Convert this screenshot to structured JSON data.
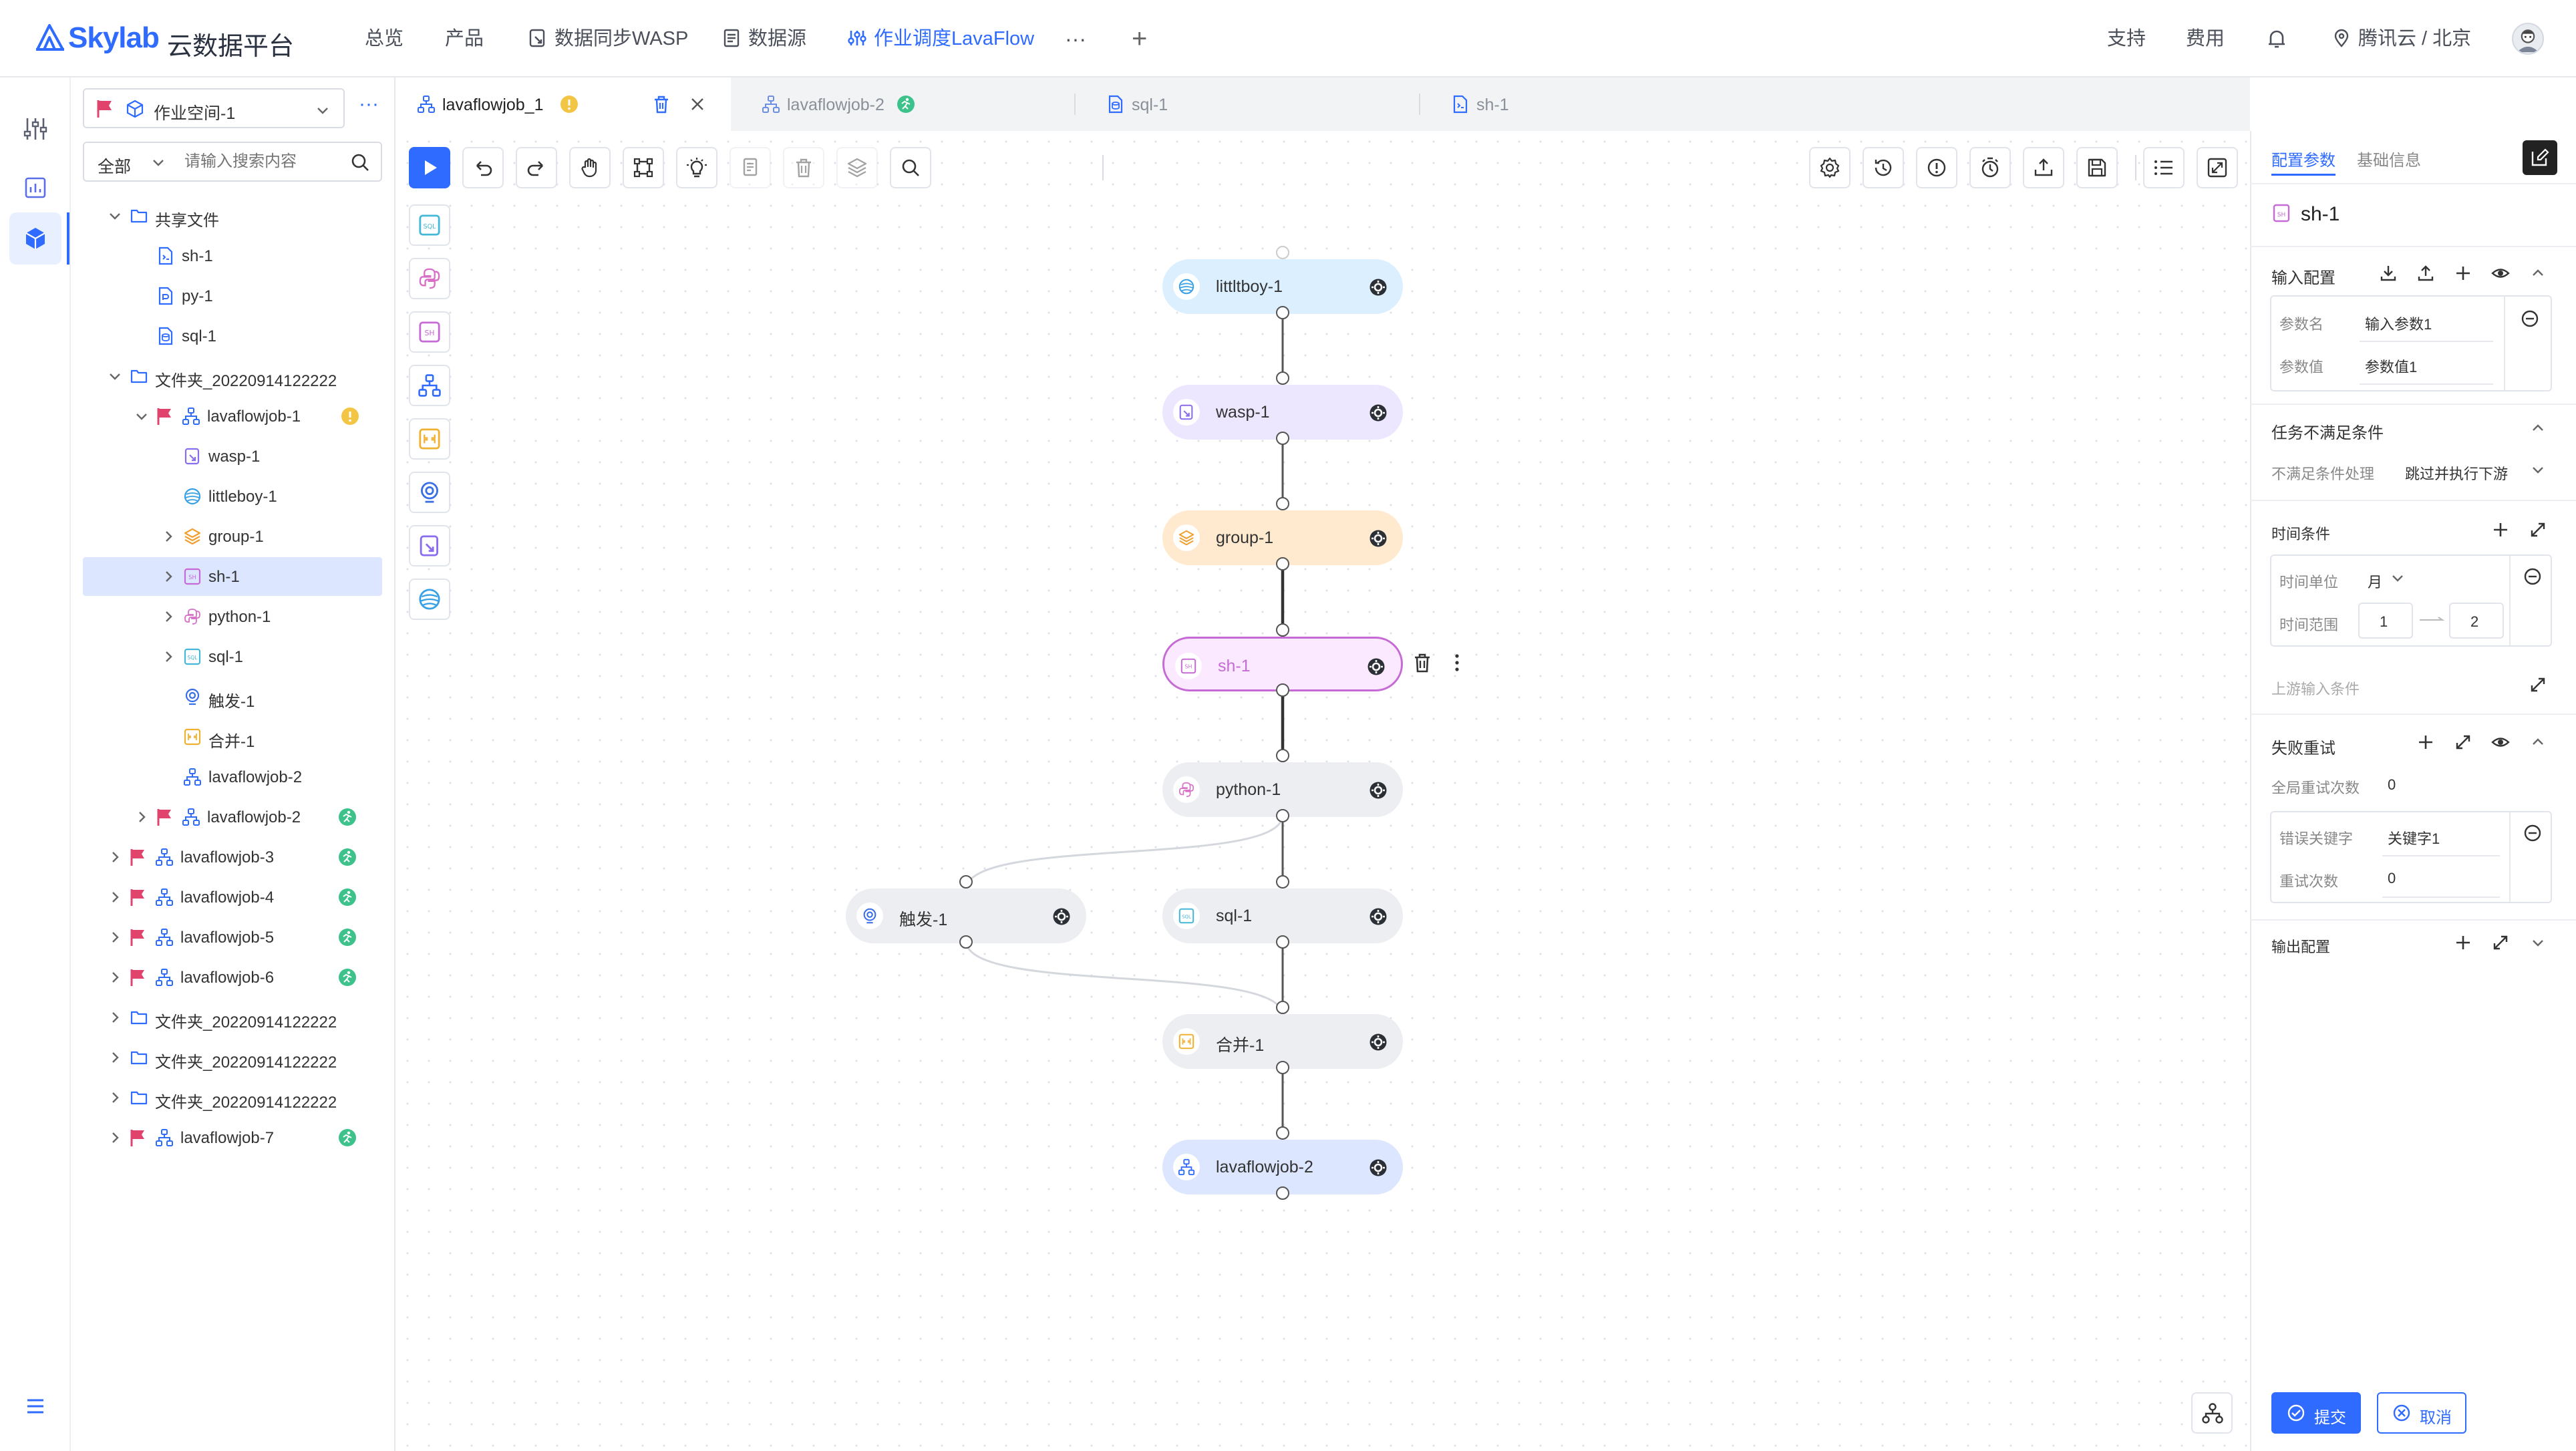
{
  "app": {
    "logo_text": "Skylab",
    "logo_suffix": "云数据平台",
    "brand_color": "#2f6bff"
  },
  "nav": {
    "items": [
      {
        "label": "总览",
        "icon": ""
      },
      {
        "label": "产品",
        "icon": ""
      },
      {
        "label": "数据同步WASP",
        "icon": "wasp-icon"
      },
      {
        "label": "数据源",
        "icon": "datasource-icon"
      },
      {
        "label": "作业调度LavaFlow",
        "icon": "lavaflow-icon",
        "active": true
      }
    ],
    "more": "···",
    "add": "+",
    "support": "支持",
    "cost": "费用",
    "region": "腾讯云 / 北京"
  },
  "workspace": {
    "selected": "作业空间-1",
    "filter": "全部",
    "search_placeholder": "请输入搜索内容"
  },
  "tree": [
    {
      "label": "共享文件",
      "icon": "folder-icon",
      "level": 0,
      "chevron": "down"
    },
    {
      "label": "sh-1",
      "icon": "sh-file-icon",
      "level": 1
    },
    {
      "label": "py-1",
      "icon": "py-file-icon",
      "level": 1
    },
    {
      "label": "sql-1",
      "icon": "sql-file-icon",
      "level": 1
    },
    {
      "label": "文件夹_20220914122222",
      "icon": "folder-icon",
      "level": 0,
      "chevron": "down"
    },
    {
      "label": "lavaflowjob-1",
      "icon": "flow-icon",
      "level": 1,
      "chevron": "down",
      "flag": true,
      "badge": "warning"
    },
    {
      "label": "wasp-1",
      "icon": "wasp-icon",
      "level": 2
    },
    {
      "label": "littleboy-1",
      "icon": "littleboy-icon",
      "level": 2
    },
    {
      "label": "group-1",
      "icon": "group-icon",
      "level": 2,
      "chevron": "right"
    },
    {
      "label": "sh-1",
      "icon": "sh-icon",
      "level": 2,
      "chevron": "right",
      "selected": true
    },
    {
      "label": "python-1",
      "icon": "python-icon",
      "level": 2,
      "chevron": "right"
    },
    {
      "label": "sql-1",
      "icon": "sql-icon",
      "level": 2,
      "chevron": "right"
    },
    {
      "label": "触发-1",
      "icon": "trigger-icon",
      "level": 2
    },
    {
      "label": "合并-1",
      "icon": "merge-icon",
      "level": 2
    },
    {
      "label": "lavaflowjob-2",
      "icon": "flow-icon",
      "level": 2
    },
    {
      "label": "lavaflowjob-2",
      "icon": "flow-icon",
      "level": 1,
      "chevron": "right",
      "flag": true,
      "badge": "running"
    },
    {
      "label": "lavaflowjob-3",
      "icon": "flow-icon",
      "level": 0,
      "chevron": "right",
      "flag": true,
      "badge": "running"
    },
    {
      "label": "lavaflowjob-4",
      "icon": "flow-icon",
      "level": 0,
      "chevron": "right",
      "flag": true,
      "badge": "running"
    },
    {
      "label": "lavaflowjob-5",
      "icon": "flow-icon",
      "level": 0,
      "chevron": "right",
      "flag": true,
      "badge": "running"
    },
    {
      "label": "lavaflowjob-6",
      "icon": "flow-icon",
      "level": 0,
      "chevron": "right",
      "flag": true,
      "badge": "running"
    },
    {
      "label": "文件夹_20220914122222",
      "icon": "folder-icon",
      "level": 0,
      "chevron": "right"
    },
    {
      "label": "文件夹_20220914122222",
      "icon": "folder-icon",
      "level": 0,
      "chevron": "right"
    },
    {
      "label": "文件夹_20220914122222",
      "icon": "folder-icon",
      "level": 0,
      "chevron": "right"
    },
    {
      "label": "lavaflowjob-7",
      "icon": "flow-icon",
      "level": 0,
      "chevron": "right",
      "flag": true,
      "badge": "running"
    }
  ],
  "tabs": [
    {
      "label": "lavaflowjob_1",
      "icon": "flow-icon",
      "active": true,
      "badge": "warning"
    },
    {
      "label": "lavaflowjob-2",
      "icon": "flow-icon",
      "badge": "running"
    },
    {
      "label": "sql-1",
      "icon": "sql-file-icon"
    },
    {
      "label": "sh-1",
      "icon": "sh-file-icon"
    }
  ],
  "nodes": [
    {
      "label": "littltboy-1",
      "icon": "littleboy-icon",
      "bg": "#dcefff",
      "accent": "#3aa0e6"
    },
    {
      "label": "wasp-1",
      "icon": "wasp-icon",
      "bg": "#ece6ff",
      "accent": "#8a6cf0"
    },
    {
      "label": "group-1",
      "icon": "group-icon",
      "bg": "#ffeacf",
      "accent": "#f0a030"
    },
    {
      "label": "sh-1",
      "icon": "sh-icon",
      "bg": "#fbe9ff",
      "accent": "#c66ad6",
      "selected": true
    },
    {
      "label": "python-1",
      "icon": "python-icon",
      "bg": "#eceef2",
      "accent": "#d86ec6"
    },
    {
      "label": "触发-1",
      "icon": "trigger-icon",
      "bg": "#eceef2",
      "accent": "#3a6ee6"
    },
    {
      "label": "sql-1",
      "icon": "sql-icon",
      "bg": "#eceef2",
      "accent": "#44b8d8"
    },
    {
      "label": "合并-1",
      "icon": "merge-icon",
      "bg": "#eceef2",
      "accent": "#f0b030"
    },
    {
      "label": "lavaflowjob-2",
      "icon": "flow-icon",
      "bg": "#dde6ff",
      "accent": "#2f6bff"
    }
  ],
  "panel": {
    "tab_config": "配置参数",
    "tab_basic": "基础信息",
    "title": "sh-1",
    "input_config": {
      "heading": "输入配置",
      "param_name_label": "参数名",
      "param_name_value": "输入参数1",
      "param_value_label": "参数值",
      "param_value_value": "参数值1"
    },
    "unmet": {
      "heading": "任务不满足条件",
      "handling_label": "不满足条件处理",
      "handling_value": "跳过并执行下游",
      "time_heading": "时间条件",
      "unit_label": "时间单位",
      "unit_value": "月",
      "range_label": "时间范围",
      "range_from": "1",
      "range_to": "2",
      "upstream_label": "上游输入条件"
    },
    "retry": {
      "heading": "失败重试",
      "global_label": "全局重试次数",
      "global_value": "0",
      "keyword_label": "错误关键字",
      "keyword_value": "关键字1",
      "count_label": "重试次数",
      "count_value": "0"
    },
    "output_heading": "输出配置",
    "submit": "提交",
    "cancel": "取消"
  }
}
